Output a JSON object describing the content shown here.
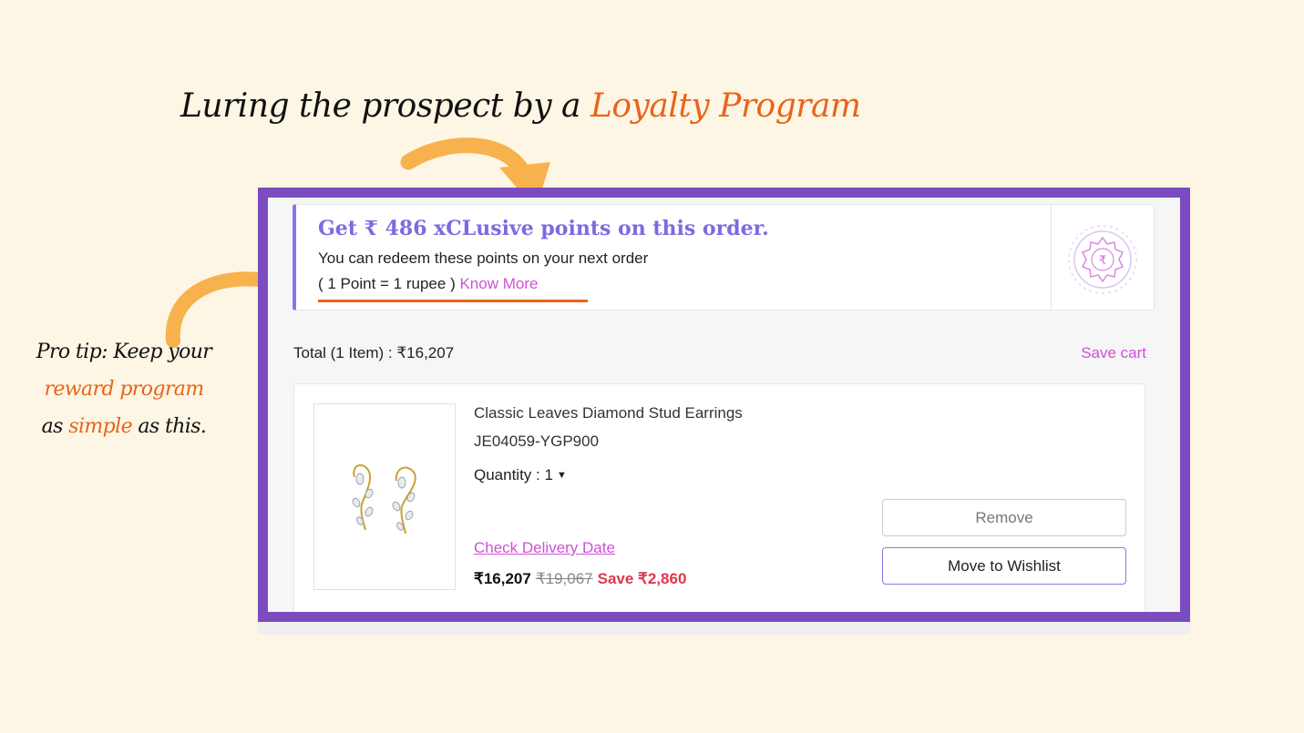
{
  "headline": {
    "prefix": "Luring the prospect by a ",
    "accent": "Loyalty Program"
  },
  "protip": {
    "line1": "Pro tip: Keep your",
    "line2_accent": "reward program",
    "line3_prefix": "as ",
    "line3_accent": "simple",
    "line3_suffix": " as this."
  },
  "loyalty": {
    "title": "Get ₹ 486 xCLusive points on this order.",
    "subtitle": "You can redeem these points on your next order",
    "rate": "( 1 Point = 1 rupee ) ",
    "know_more": "Know More",
    "badge_icon": "rupee-seal-icon"
  },
  "cart": {
    "total": "Total (1 Item) : ₹16,207",
    "save_cart": "Save cart"
  },
  "item": {
    "name": "Classic Leaves Diamond Stud Earrings",
    "code": "JE04059-YGP900",
    "quantity_label": "Quantity : 1",
    "check_delivery": "Check Delivery Date",
    "price": "₹16,207",
    "mrp": "₹19,067",
    "save": "Save ₹2,860",
    "remove": "Remove",
    "wishlist": "Move to Wishlist"
  },
  "colors": {
    "background": "#fdf6e4",
    "frame": "#7b4cc0",
    "accent_orange": "#e8641b",
    "loyalty_purple": "#7f69e0",
    "link_pink": "#d14fd8",
    "save_red": "#e0364c"
  }
}
